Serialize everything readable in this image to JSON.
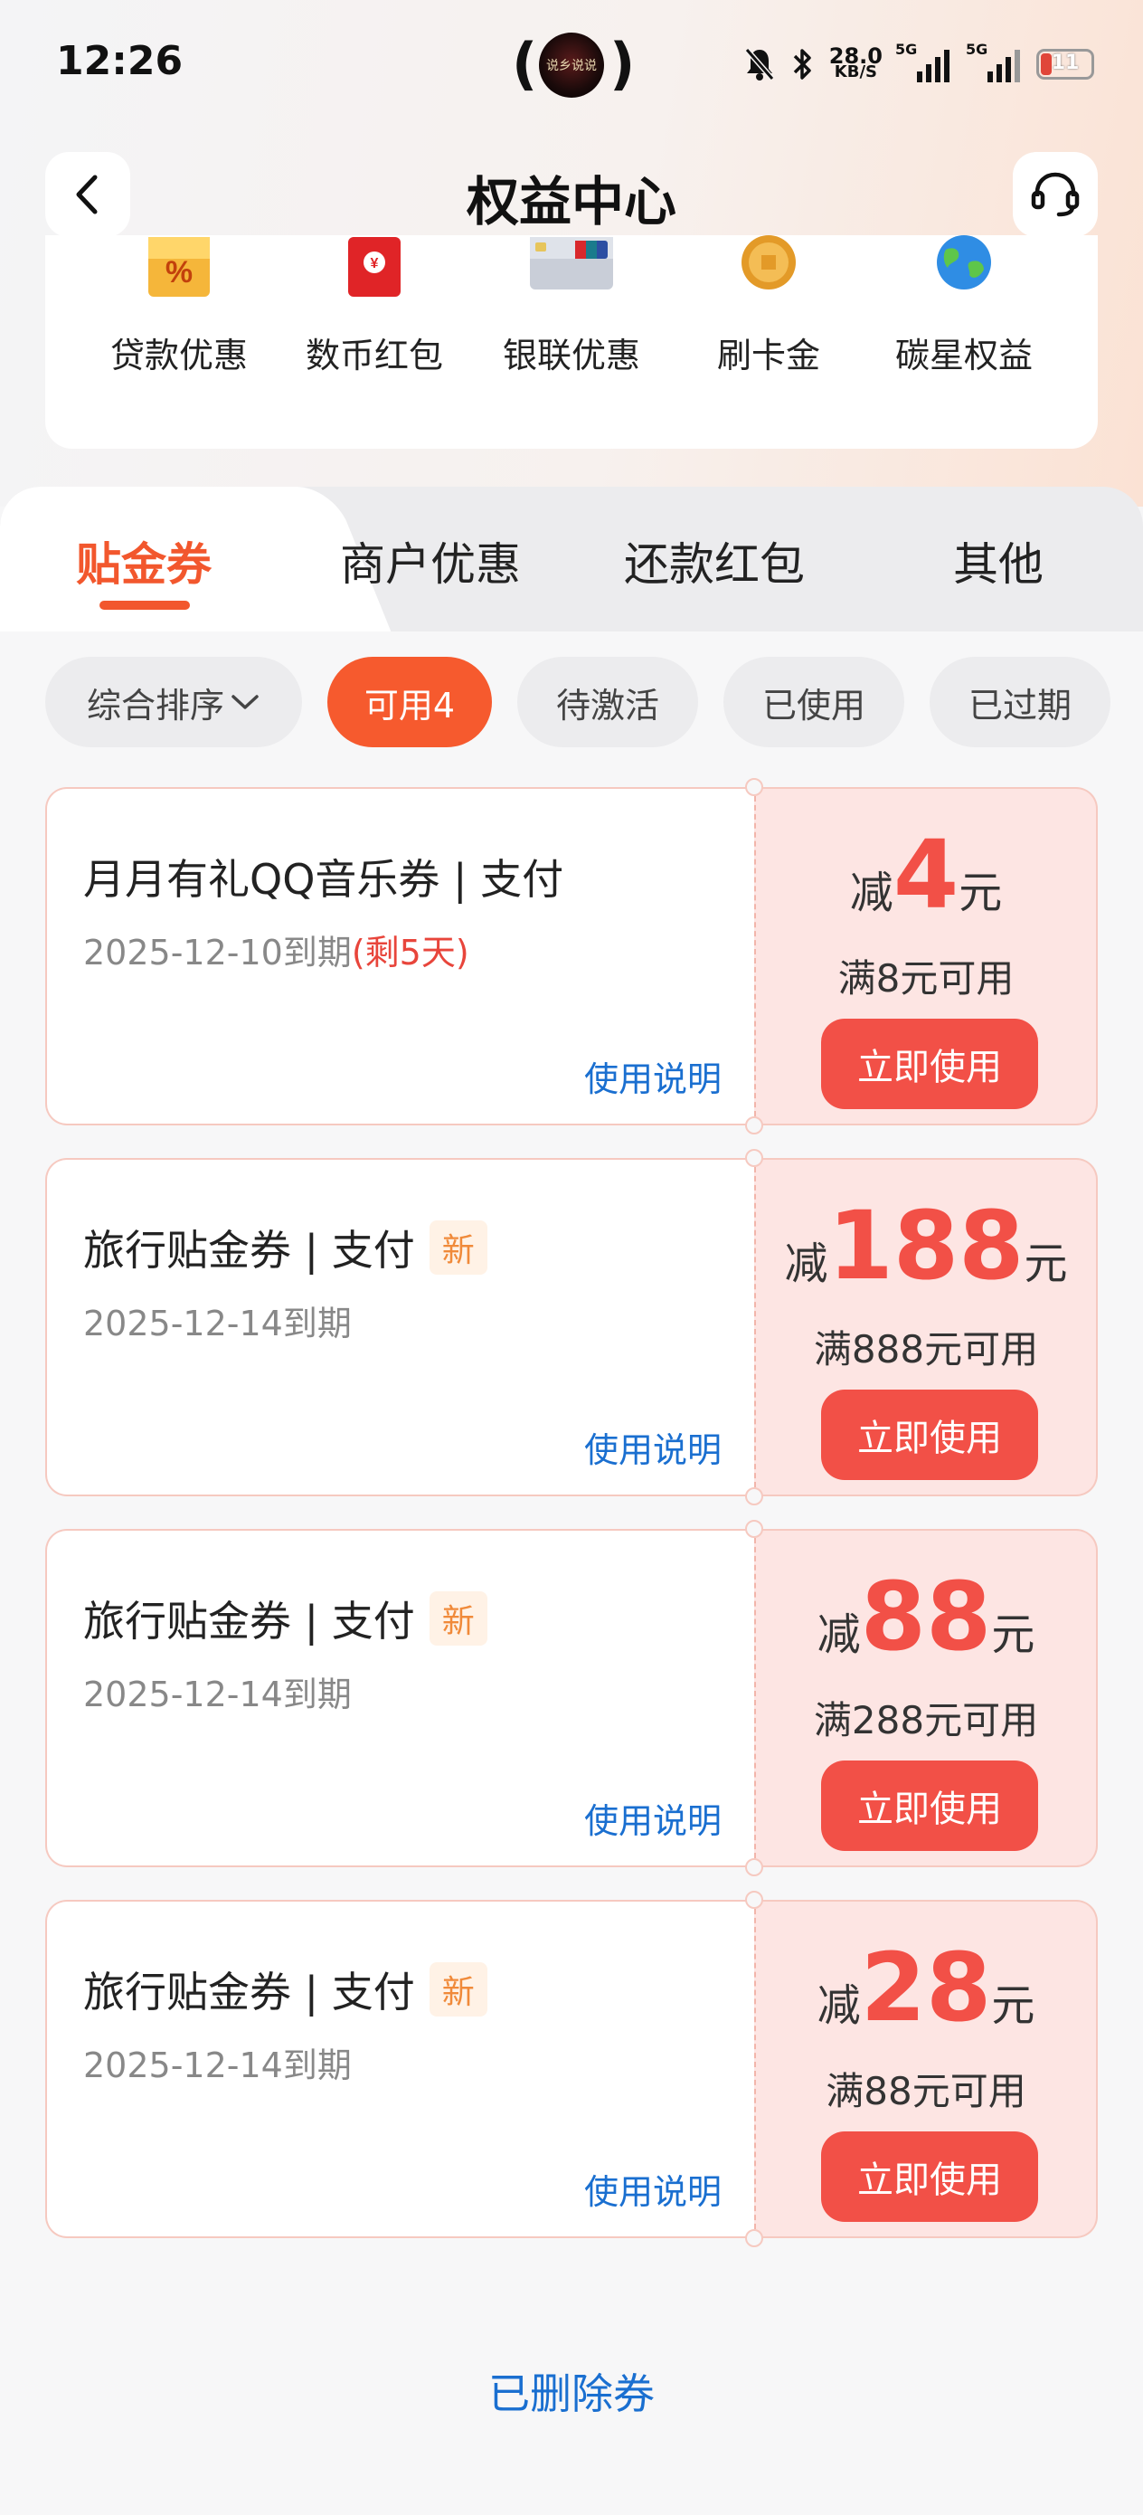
{
  "status_bar": {
    "time": "12:26",
    "center_logo_text": "说乡说说",
    "net_speed": "28.0",
    "net_unit": "KB/S",
    "signal_1_label": "5G",
    "signal_2_label": "5G",
    "battery": "11",
    "icons": [
      "bell-off-icon",
      "bluetooth-icon"
    ]
  },
  "nav": {
    "title": "权益中心",
    "back_icon": "chevron-left-icon",
    "support_icon": "headset-icon"
  },
  "categories": [
    {
      "label": "贷款优惠",
      "icon": "percent-icon"
    },
    {
      "label": "数币红包",
      "icon": "red-envelope-icon"
    },
    {
      "label": "银联优惠",
      "icon": "unionpay-card-icon"
    },
    {
      "label": "刷卡金",
      "icon": "gold-coin-icon"
    },
    {
      "label": "碳星权益",
      "icon": "earth-icon"
    }
  ],
  "tabs": [
    {
      "label": "贴金券",
      "active": true
    },
    {
      "label": "商户优惠",
      "active": false
    },
    {
      "label": "还款红包",
      "active": false
    },
    {
      "label": "其他",
      "active": false
    }
  ],
  "filters": [
    {
      "label": "综合排序",
      "dropdown": true
    },
    {
      "label": "可用4",
      "active": true
    },
    {
      "label": "待激活"
    },
    {
      "label": "已使用"
    },
    {
      "label": "已过期"
    }
  ],
  "coupons": [
    {
      "title": "月月有礼QQ音乐券 | 支付",
      "badge": "",
      "expiry": "2025-12-10到期",
      "expiry_note": "(剩5天)",
      "help": "使用说明",
      "prefix": "减",
      "amount": "4",
      "suffix": "元",
      "condition": "满8元可用",
      "button": "立即使用"
    },
    {
      "title": "旅行贴金券 | 支付",
      "badge": "新",
      "expiry": "2025-12-14到期",
      "expiry_note": "",
      "help": "使用说明",
      "prefix": "减",
      "amount": "188",
      "suffix": "元",
      "condition": "满888元可用",
      "button": "立即使用"
    },
    {
      "title": "旅行贴金券 | 支付",
      "badge": "新",
      "expiry": "2025-12-14到期",
      "expiry_note": "",
      "help": "使用说明",
      "prefix": "减",
      "amount": "88",
      "suffix": "元",
      "condition": "满288元可用",
      "button": "立即使用"
    },
    {
      "title": "旅行贴金券 | 支付",
      "badge": "新",
      "expiry": "2025-12-14到期",
      "expiry_note": "",
      "help": "使用说明",
      "prefix": "减",
      "amount": "28",
      "suffix": "元",
      "condition": "满88元可用",
      "button": "立即使用"
    }
  ],
  "footer": {
    "deleted_link": "已删除券"
  },
  "colors": {
    "accent": "#f2572d",
    "coupon_red": "#f25047",
    "link_blue": "#1a6fd0"
  }
}
